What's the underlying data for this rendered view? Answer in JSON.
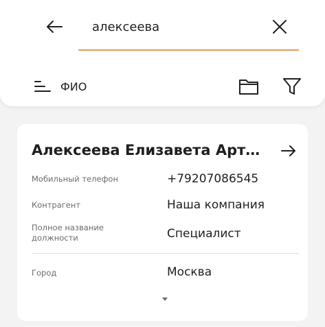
{
  "search": {
    "value": "алексеева"
  },
  "toolbar": {
    "sort_label": "ФИО"
  },
  "card": {
    "title": "Алексеева Елизавета Артёмовна",
    "fields": [
      {
        "label": "Мобильный телефон",
        "value": "+79207086545"
      },
      {
        "label": "Контрагент",
        "value": "Наша компания"
      },
      {
        "label": "Полное название должности",
        "value": "Специалист"
      },
      {
        "label": "Город",
        "value": "Москва"
      }
    ]
  },
  "icons": {
    "back": "arrow-left-icon",
    "clear": "close-icon",
    "sort": "sort-lines-icon",
    "folder": "folder-icon",
    "filter": "filter-funnel-icon",
    "open": "arrow-right-icon",
    "expand": "caret-down-icon"
  },
  "colors": {
    "accent": "#e39a57",
    "background": "#f3f3f3",
    "card": "#ffffff"
  }
}
